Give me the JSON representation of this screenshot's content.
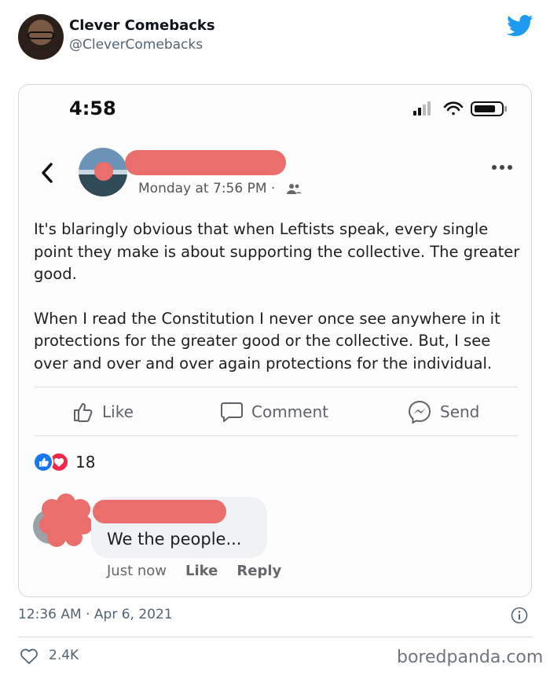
{
  "tweet": {
    "display_name": "Clever Comebacks",
    "handle": "@CleverComebacks",
    "date": "12:36 AM · Apr 6, 2021",
    "likes": "2.4K",
    "colors": {
      "brand": "#1d9bf0",
      "secondary_text": "#536471"
    }
  },
  "screenshot": {
    "status_time": "4:58",
    "post": {
      "meta": "Monday at 7:56 PM ·",
      "paragraph_1": "It's blaringly obvious that when Leftists speak, every single point they make is about supporting the collective. The greater good.",
      "paragraph_2": "When I read the Constitution I never once see anywhere in it protections for the greater good or the collective. But, I see over and over and over again protections for the individual."
    },
    "actions": {
      "like": "Like",
      "comment": "Comment",
      "send": "Send"
    },
    "reaction_count": "18",
    "comment": {
      "text": "We the people...",
      "time": "Just now",
      "like": "Like",
      "reply": "Reply"
    },
    "colors": {
      "redaction": "#ea6f6c",
      "like_reaction": "#1877f2",
      "love_reaction": "#f02849"
    }
  },
  "watermark": "boredpanda.com"
}
